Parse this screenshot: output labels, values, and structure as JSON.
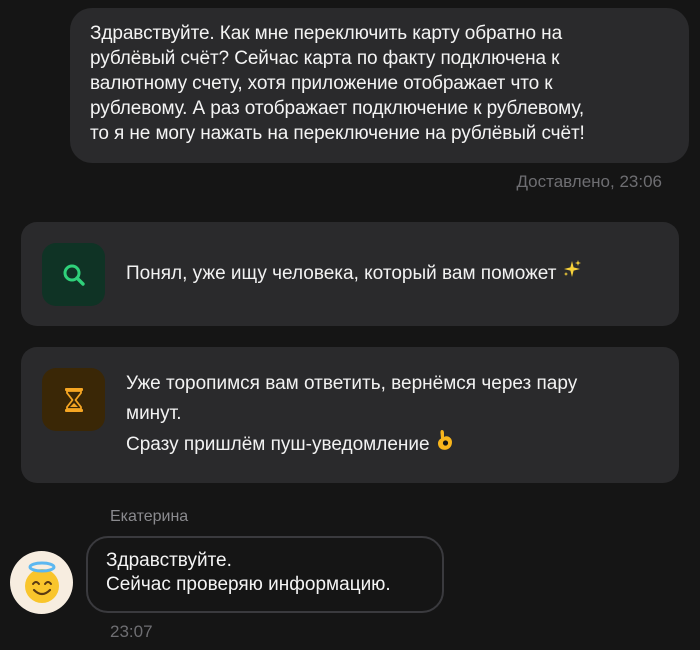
{
  "user_message": {
    "text": "Здравствуйте. Как мне переключить карту обратно на\nрублёвый счёт? Сейчас карта по факту подключена к\nвалютному счету, хотя приложение отображает что к\nрублевому. А раз отображает подключение к рублевому,\nто я не могу нажать на переключение на рублёвый счёт!",
    "status": "Доставлено, 23:06"
  },
  "system_cards": {
    "search": {
      "icon": "magnifier-icon",
      "text": "Понял, уже ищу человека, который вам поможет",
      "emoji": "sparkles-icon"
    },
    "wait": {
      "icon": "hourglass-icon",
      "line1": "Уже торопимся вам ответить, вернёмся через пару",
      "line2": "минут.",
      "line3": "Сразу пришлём пуш-уведомление",
      "emoji": "ok-hand-icon"
    }
  },
  "agent": {
    "name": "Екатерина",
    "avatar": "smiling-face-with-halo-icon",
    "message_line1": "Здравствуйте.",
    "message_line2": "Сейчас проверяю информацию.",
    "time": "23:07"
  },
  "colors": {
    "background": "#151515",
    "bubble": "#2a2a2c",
    "search_icon_bg": "#0f3325",
    "search_icon": "#2fd17a",
    "wait_icon_bg": "#3a2706",
    "wait_icon": "#f5a623",
    "muted_text": "#6e6e72"
  }
}
